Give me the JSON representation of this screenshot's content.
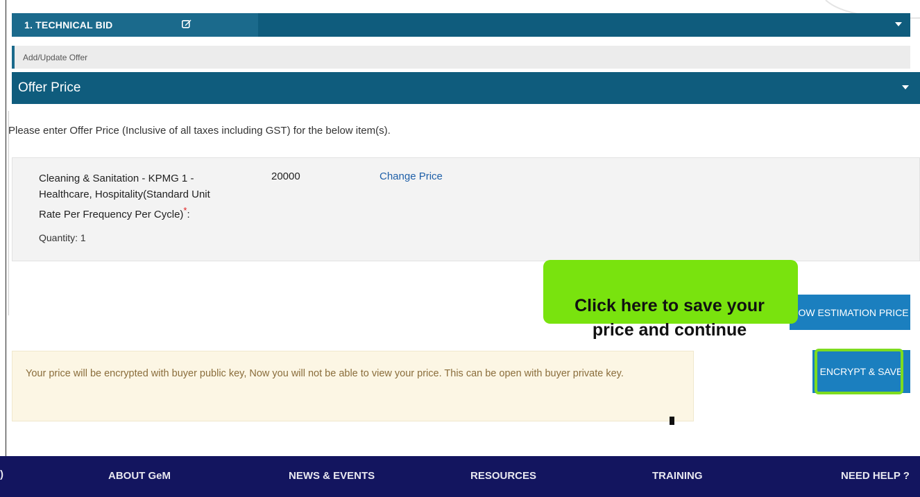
{
  "technical_bid": {
    "title": "1. TECHNICAL BID"
  },
  "subsection": {
    "label": "Add/Update Offer"
  },
  "offer_price": {
    "title": "Offer Price",
    "instruction": "Please enter Offer Price (Inclusive of all taxes including GST) for the below item(s).",
    "item": {
      "name": "Cleaning & Sanitation - KPMG 1 - Healthcare, Hospitality(Standard Unit Rate Per Frequency Per Cycle)",
      "required_mark": "*",
      "name_suffix": ":",
      "quantity": "Quantity: 1",
      "price": "20000",
      "change_price_label": "Change Price"
    },
    "estimation_button_label": "HOW ESTIMATION PRICE",
    "warning": "Your price will be encrypted with buyer public key, Now you will not be able to view your price. This can be open with buyer private key.",
    "encrypt_button_label": "ENCRYPT & SAVE"
  },
  "callout": {
    "text": "Click here to save your price and continue"
  },
  "footer": {
    "edge": ")",
    "items": [
      "ABOUT GeM",
      "NEWS & EVENTS",
      "RESOURCES",
      "TRAINING",
      "NEED HELP ?"
    ]
  },
  "colors": {
    "header_bar": "#0f5c7d",
    "button_blue": "#1b7fbf",
    "callout_green": "#79e30e",
    "footer_navy": "#13155f",
    "warning_bg": "#fcf6e4"
  },
  "icons": [
    "edit-icon",
    "caret-down-icon"
  ]
}
